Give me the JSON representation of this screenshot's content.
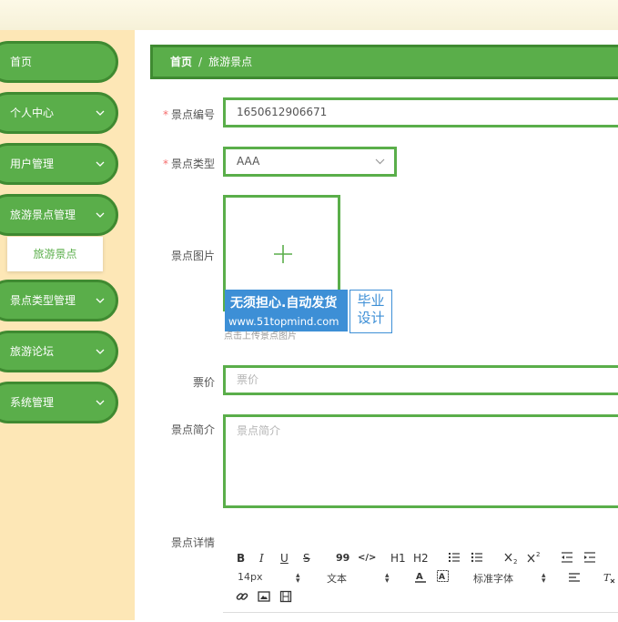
{
  "sidebar": {
    "items": [
      {
        "label": "首页",
        "has_chevron": false
      },
      {
        "label": "个人中心",
        "has_chevron": true
      },
      {
        "label": "用户管理",
        "has_chevron": true
      },
      {
        "label": "旅游景点管理",
        "has_chevron": true
      },
      {
        "label": "景点类型管理",
        "has_chevron": true
      },
      {
        "label": "旅游论坛",
        "has_chevron": true
      },
      {
        "label": "系统管理",
        "has_chevron": true
      }
    ],
    "active_sub_item": "旅游景点"
  },
  "breadcrumb": {
    "home": "首页",
    "separator": "/",
    "current": "旅游景点"
  },
  "form": {
    "id_label": "景点编号",
    "id_value": "1650612906671",
    "type_label": "景点类型",
    "type_value": "AAA",
    "image_label": "景点图片",
    "image_hint": "点击上传景点图片",
    "price_label": "票价",
    "price_placeholder": "票价",
    "intro_label": "景点简介",
    "intro_placeholder": "景点简介",
    "detail_label": "景点详情",
    "required_mark": "*"
  },
  "watermark": {
    "line1": "无须担心.自动发货",
    "line2": "www.51topmind.com",
    "right_line1": "毕业",
    "right_line2": "设计"
  },
  "editor": {
    "bold": "B",
    "italic": "I",
    "underline": "U",
    "strike": "S",
    "quote": "99",
    "code": "</>",
    "h1": "H1",
    "h2": "H2",
    "font_size": "14px",
    "text_style": "文本",
    "font_family": "标准字体"
  },
  "colors": {
    "sidebar_bg": "#fde7b6",
    "nav_green": "#5aae4a",
    "nav_border": "#3f8a31",
    "topbar": "#fbf6e2",
    "watermark_blue": "#3d8fd6",
    "required_red": "#f56c6c"
  }
}
